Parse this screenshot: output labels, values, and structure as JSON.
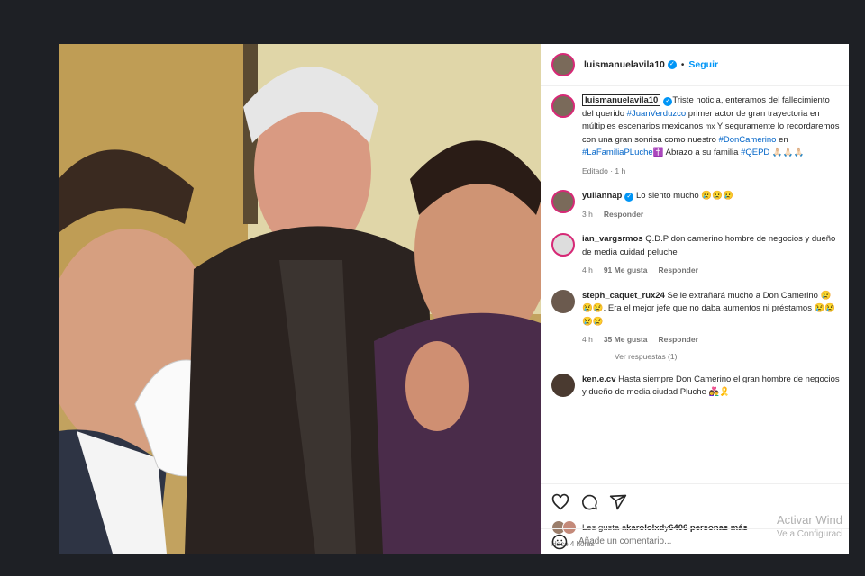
{
  "post": {
    "username": "luismanuelavila10",
    "follow_label": "Seguir",
    "dot": "•",
    "caption": {
      "text_1": "Triste noticia, enteramos del fallecimiento del querido ",
      "tag_1": "#JuanVerduzco",
      "text_2": " primer actor de gran trayectoria en múltiples escenarios mexicanos ",
      "mx": "mx",
      "text_3": " Y seguramente lo recordaremos con una gran sonrisa como nuestro ",
      "tag_2": "#DonCamerino",
      "text_4": " en ",
      "tag_3": "#LaFamiliaPLuche",
      "cross": "✝️",
      "text_5": " Abrazo a su familia ",
      "tag_4": "#QEPD",
      "emoji": " 🙏🏻🙏🏻🙏🏻",
      "edited": "Editado · 1 h"
    }
  },
  "comments": [
    {
      "user": "yuliannap",
      "verified": true,
      "text": "Lo siento mucho 😢😢😢",
      "time": "3 h",
      "likes": "",
      "reply": "Responder"
    },
    {
      "user": "ian_vargsrmos",
      "verified": false,
      "text": "Q.D.P don camerino hombre de negocios y dueño de media cuidad peluche",
      "time": "4 h",
      "likes": "91 Me gusta",
      "reply": "Responder"
    },
    {
      "user": "steph_caquet_rux24",
      "verified": false,
      "text": "Se le extrañará mucho a Don Camerino 😢😢😢. Era el mejor jefe que no daba aumentos ni préstamos 😢😢😢😢",
      "time": "4 h",
      "likes": "35 Me gusta",
      "reply": "Responder"
    },
    {
      "user": "ken.e.cv",
      "verified": false,
      "text": "Hasta siempre Don Camerino el gran hombre de negocios y dueño de media ciudad Pluche 👩‍❤️‍👨🎗️",
      "time": "",
      "likes": "",
      "reply": ""
    }
  ],
  "view_replies": "Ver respuestas (1)",
  "likes_text": {
    "prefix": "Les gusta a ",
    "user": "karololxd",
    "mid": " y ",
    "count": "6406 personas más"
  },
  "time_ago": "Hace 4 horas",
  "comment_placeholder": "Añade un comentario...",
  "watermark": {
    "line1": "Activar Wind",
    "line2": "Ve a Configuraci"
  },
  "colors": {
    "accent": "#0095f6",
    "hashtag": "#0064c8",
    "background": "#1e2025"
  }
}
